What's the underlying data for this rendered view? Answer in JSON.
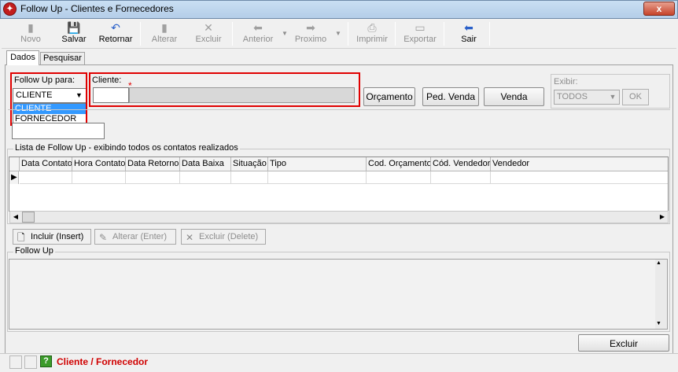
{
  "window": {
    "title": "Follow Up - Clientes e Fornecedores",
    "close_label": "x"
  },
  "toolbar": {
    "novo": "Novo",
    "salvar": "Salvar",
    "retornar": "Retornar",
    "alterar": "Alterar",
    "excluir": "Excluir",
    "anterior": "Anterior",
    "proximo": "Proximo",
    "imprimir": "Imprimir",
    "exportar": "Exportar",
    "sair": "Sair"
  },
  "tabs": {
    "dados": "Dados",
    "pesquisar": "Pesquisar"
  },
  "follow_up_para": {
    "label": "Follow Up para:",
    "selected": "CLIENTE",
    "options": [
      "CLIENTE",
      "FORNECEDOR"
    ]
  },
  "cliente": {
    "label": "Cliente:",
    "required_mark": "*",
    "code": "",
    "name": ""
  },
  "buttons": {
    "orcamento": "Orçamento",
    "ped_venda": "Ped. Venda",
    "venda": "Venda",
    "excluir": "Excluir"
  },
  "exibir": {
    "label": "Exibir:",
    "selected": "TODOS",
    "ok": "OK"
  },
  "list": {
    "title": "Lista de Follow Up - exibindo todos os contatos realizados",
    "columns": [
      "Data Contato",
      "Hora Contato",
      "Data Retorno",
      "Data Baixa",
      "Situação",
      "Tipo",
      "Cod. Orçamento",
      "Cód. Vendedor",
      "Vendedor"
    ]
  },
  "actions": {
    "incluir": "Incluir (Insert)",
    "alterar": "Alterar (Enter)",
    "excluir": "Excluir (Delete)"
  },
  "memo": {
    "title": "Follow Up"
  },
  "status": {
    "text": "Cliente / Fornecedor",
    "color": "#d00000"
  }
}
